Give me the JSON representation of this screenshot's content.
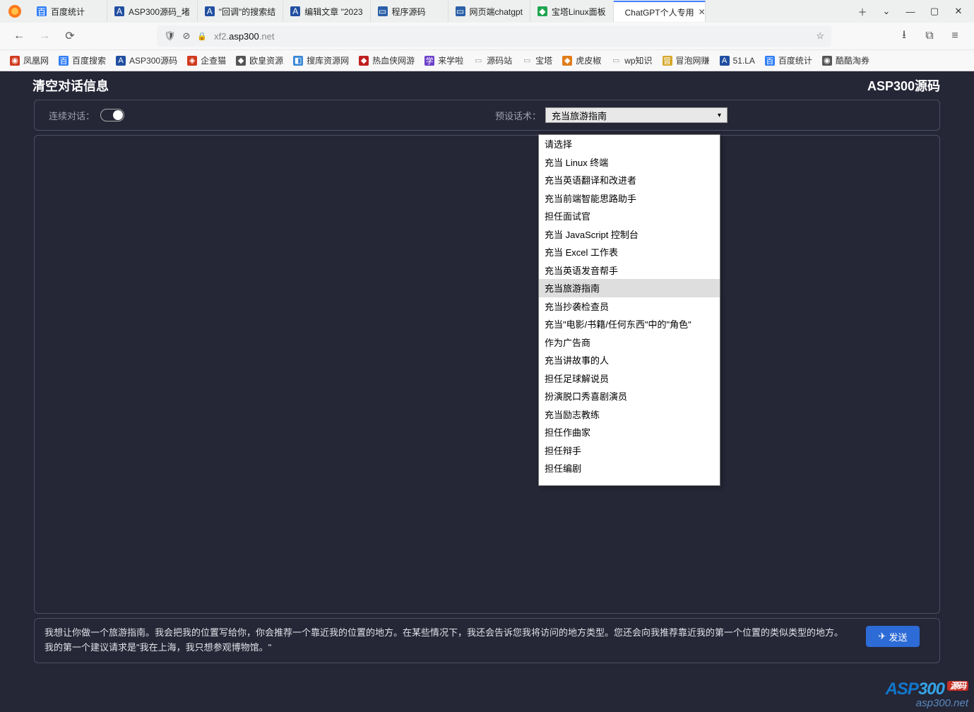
{
  "browser_tabs": [
    {
      "label": "百度统计",
      "icon_bg": "#2f7df6",
      "glyph": "百"
    },
    {
      "label": "ASP300源码_堵",
      "icon_bg": "#214fa0",
      "glyph": "A"
    },
    {
      "label": "\"回调\"的搜索结",
      "icon_bg": "#214fa0",
      "glyph": "A"
    },
    {
      "label": "编辑文章 \"2023",
      "icon_bg": "#214fa0",
      "glyph": "A"
    },
    {
      "label": "程序源码",
      "icon_bg": "#2b5fa8",
      "glyph": "▭"
    },
    {
      "label": "网页端chatgpt",
      "icon_bg": "#2b5fa8",
      "glyph": "▭"
    },
    {
      "label": "宝塔Linux面板",
      "icon_bg": "#1ea550",
      "glyph": "◆"
    },
    {
      "label": "ChatGPT个人专用",
      "icon_bg": "#ffffff",
      "glyph": ""
    }
  ],
  "active_tab_index": 7,
  "address_bar": {
    "prefix": "xf2.",
    "host": "asp300",
    "suffix": ".net"
  },
  "bookmarks": [
    {
      "label": "凤凰网",
      "bg": "#d13a1e",
      "glyph": "◉"
    },
    {
      "label": "百度搜索",
      "bg": "#2f7df6",
      "glyph": "百"
    },
    {
      "label": "ASP300源码",
      "bg": "#214fa0",
      "glyph": "A"
    },
    {
      "label": "企查猫",
      "bg": "#d13a1e",
      "glyph": "◈"
    },
    {
      "label": "欧皇资源",
      "bg": "#555",
      "glyph": "◆"
    },
    {
      "label": "搜库资源网",
      "bg": "#3a87d6",
      "glyph": "◧"
    },
    {
      "label": "热血侠网游",
      "bg": "#c02020",
      "glyph": "◆"
    },
    {
      "label": "来学啦",
      "bg": "#6b3fc9",
      "glyph": "学"
    },
    {
      "label": "源码站",
      "bg": "transparent",
      "glyph": "▭",
      "folder": true
    },
    {
      "label": "宝塔",
      "bg": "transparent",
      "glyph": "▭",
      "folder": true
    },
    {
      "label": "虎皮椒",
      "bg": "#e07d1a",
      "glyph": "◆"
    },
    {
      "label": "wp知识",
      "bg": "transparent",
      "glyph": "▭",
      "folder": true
    },
    {
      "label": "冒泡网赚",
      "bg": "#d6a82a",
      "glyph": "冒"
    },
    {
      "label": "51.LA",
      "bg": "#214fa0",
      "glyph": "A"
    },
    {
      "label": "百度统计",
      "bg": "#2f7df6",
      "glyph": "百"
    },
    {
      "label": "酷酷淘券",
      "bg": "#555",
      "glyph": "◉"
    }
  ],
  "app": {
    "title_left": "清空对话信息",
    "title_right": "ASP300源码",
    "continuous_label": "连续对话：",
    "preset_label": "预设话术：",
    "preset_selected": "充当旅游指南",
    "dropdown_options": [
      "请选择",
      "充当 Linux 终端",
      "充当英语翻译和改进者",
      "充当前端智能思路助手",
      "担任面试官",
      "充当 JavaScript 控制台",
      "充当 Excel 工作表",
      "充当英语发音帮手",
      "充当旅游指南",
      "充当抄袭检查员",
      "充当\"电影/书籍/任何东西\"中的\"角色\"",
      "作为广告商",
      "充当讲故事的人",
      "担任足球解说员",
      "扮演脱口秀喜剧演员",
      "充当励志教练",
      "担任作曲家",
      "担任辩手",
      "担任编剧"
    ],
    "dropdown_selected_index": 8,
    "prompt_text": "我想让你做一个旅游指南。我会把我的位置写给你，你会推荐一个靠近我的位置的地方。在某些情况下，我还会告诉您我将访问的地方类型。您还会向我推荐靠近我的第一个位置的类似类型的地方。我的第一个建议请求是\"我在上海，我只想参观博物馆。\"",
    "send_label": "发送"
  },
  "watermark": {
    "l1a": "ASP",
    "l1b": "300",
    "badge": "源码",
    "l2": "asp300.net"
  }
}
